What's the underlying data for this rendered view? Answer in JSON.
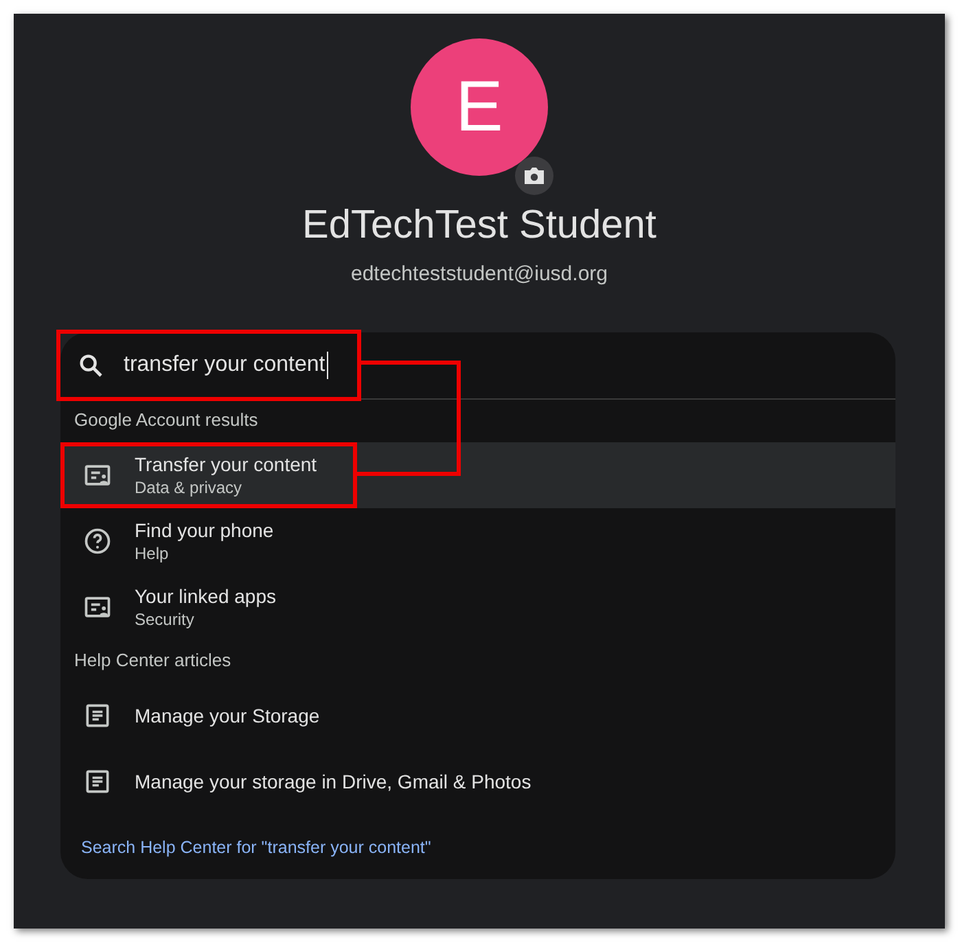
{
  "profile": {
    "initial": "E",
    "name": "EdTechTest Student",
    "email": "edtechteststudent@iusd.org"
  },
  "search": {
    "value": "transfer your content",
    "focused": true,
    "annotated": true
  },
  "sections": [
    {
      "heading": "Google Account results",
      "items": [
        {
          "kind": "account",
          "title": "Transfer your content",
          "subtitle": "Data & privacy",
          "selected": true,
          "annotated": true
        },
        {
          "kind": "help",
          "title": "Find your phone",
          "subtitle": "Help",
          "selected": false,
          "annotated": false
        },
        {
          "kind": "account",
          "title": "Your linked apps",
          "subtitle": "Security",
          "selected": false,
          "annotated": false
        }
      ]
    },
    {
      "heading": "Help Center articles",
      "items": [
        {
          "kind": "article",
          "title": "Manage your Storage",
          "selected": false,
          "annotated": false
        },
        {
          "kind": "article",
          "title": "Manage your storage in Drive, Gmail & Photos",
          "selected": false,
          "annotated": false
        }
      ]
    }
  ],
  "footer_link": "Search Help Center for \"transfer your content\""
}
